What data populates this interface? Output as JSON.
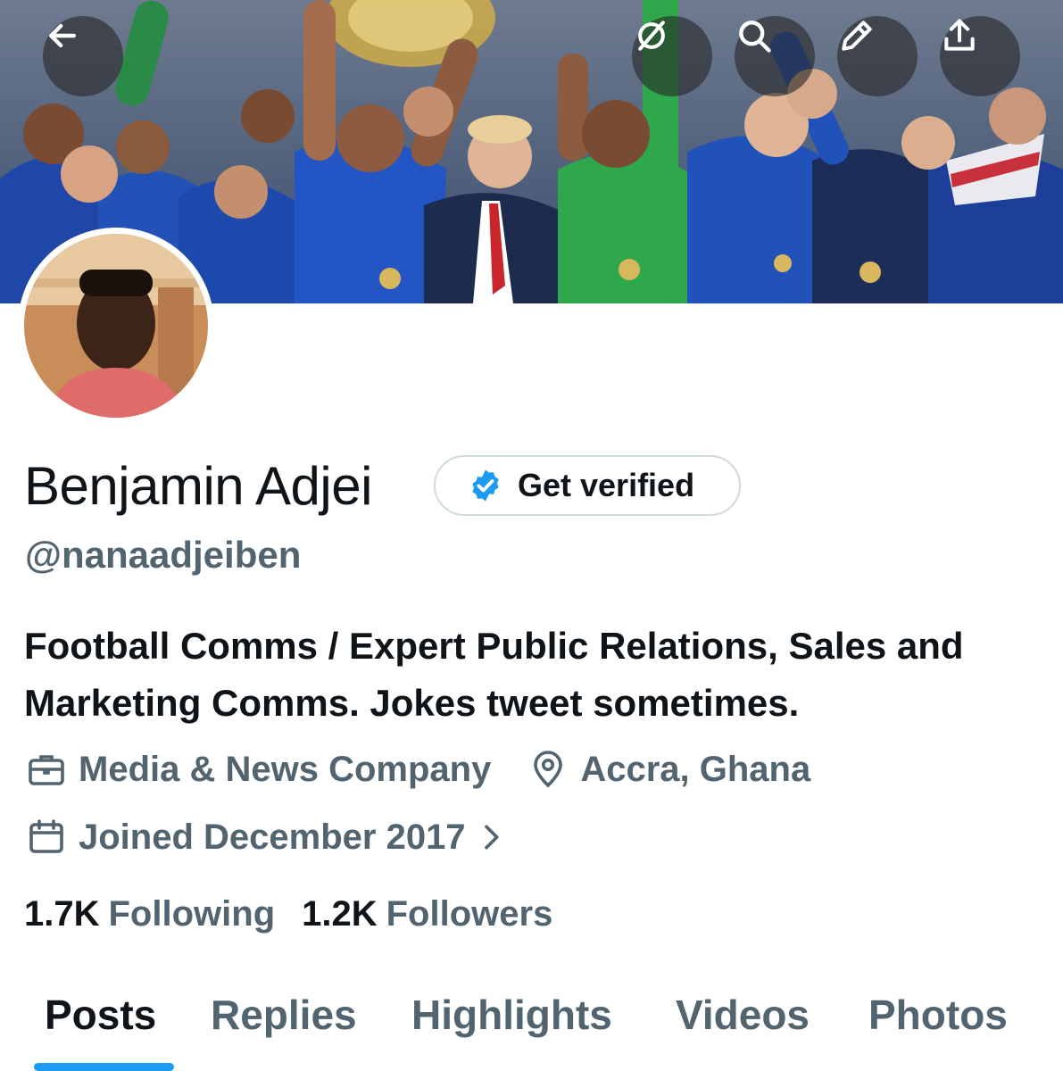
{
  "header": {
    "back_icon": "arrow-left-icon",
    "grok_icon": "grok-icon",
    "search_icon": "search-icon",
    "edit_icon": "pencil-icon",
    "share_icon": "share-icon"
  },
  "profile": {
    "name": "Benjamin Adjei",
    "handle": "@nanaadjeiben",
    "verify_label": "Get verified",
    "bio": "Football Comms / Expert Public Relations, Sales and Marketing Comms. Jokes tweet sometimes.",
    "category": "Media & News Company",
    "location": "Accra, Ghana",
    "joined": "Joined December 2017"
  },
  "stats": {
    "following_count": "1.7K",
    "following_label": "Following",
    "followers_count": "1.2K",
    "followers_label": "Followers"
  },
  "tabs": [
    {
      "label": "Posts",
      "active": true
    },
    {
      "label": "Replies",
      "active": false
    },
    {
      "label": "Highlights",
      "active": false
    },
    {
      "label": "Videos",
      "active": false
    },
    {
      "label": "Photos",
      "active": false
    }
  ],
  "colors": {
    "accent": "#1d9bf0",
    "secondary_text": "#536471",
    "primary_text": "#0f1419"
  }
}
